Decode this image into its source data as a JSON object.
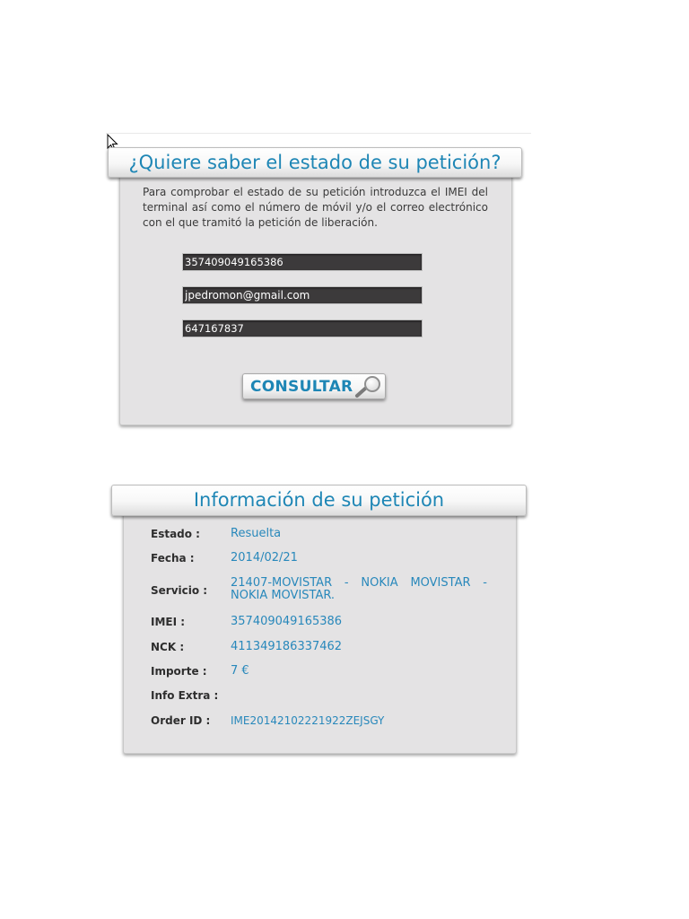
{
  "query_panel": {
    "title": "¿Quiere saber el estado de su petición?",
    "intro": "Para comprobar el estado de su petición introduzca el IMEI del terminal así como el número de móvil y/o el correo electrónico con el que tramitó la petición de liberación.",
    "fields": {
      "imei": "357409049165386",
      "email": "jpedromon@gmail.com",
      "phone": "647167837"
    },
    "button_label": "CONSULTAR",
    "button_icon": "magnifier-icon"
  },
  "info_panel": {
    "title": "Información de su petición",
    "rows": [
      {
        "label": "Estado :",
        "value": "Resuelta"
      },
      {
        "label": "Fecha :",
        "value": "2014/02/21"
      },
      {
        "label": "Servicio :",
        "value": "21407-MOVISTAR - NOKIA MOVISTAR - NOKIA MOVISTAR."
      },
      {
        "label": "IMEI :",
        "value": "357409049165386"
      },
      {
        "label": "NCK :",
        "value": "411349186337462"
      },
      {
        "label": "Importe :",
        "value": "7 €"
      },
      {
        "label": "Info Extra :",
        "value": ""
      },
      {
        "label": "Order ID :",
        "value": "IME20142102221922ZEJSGY"
      }
    ]
  },
  "colors": {
    "accent": "#1e86b5",
    "value_text": "#2888bb",
    "panel_bg": "#e4e3e4",
    "field_bg": "#3c3a3b"
  }
}
